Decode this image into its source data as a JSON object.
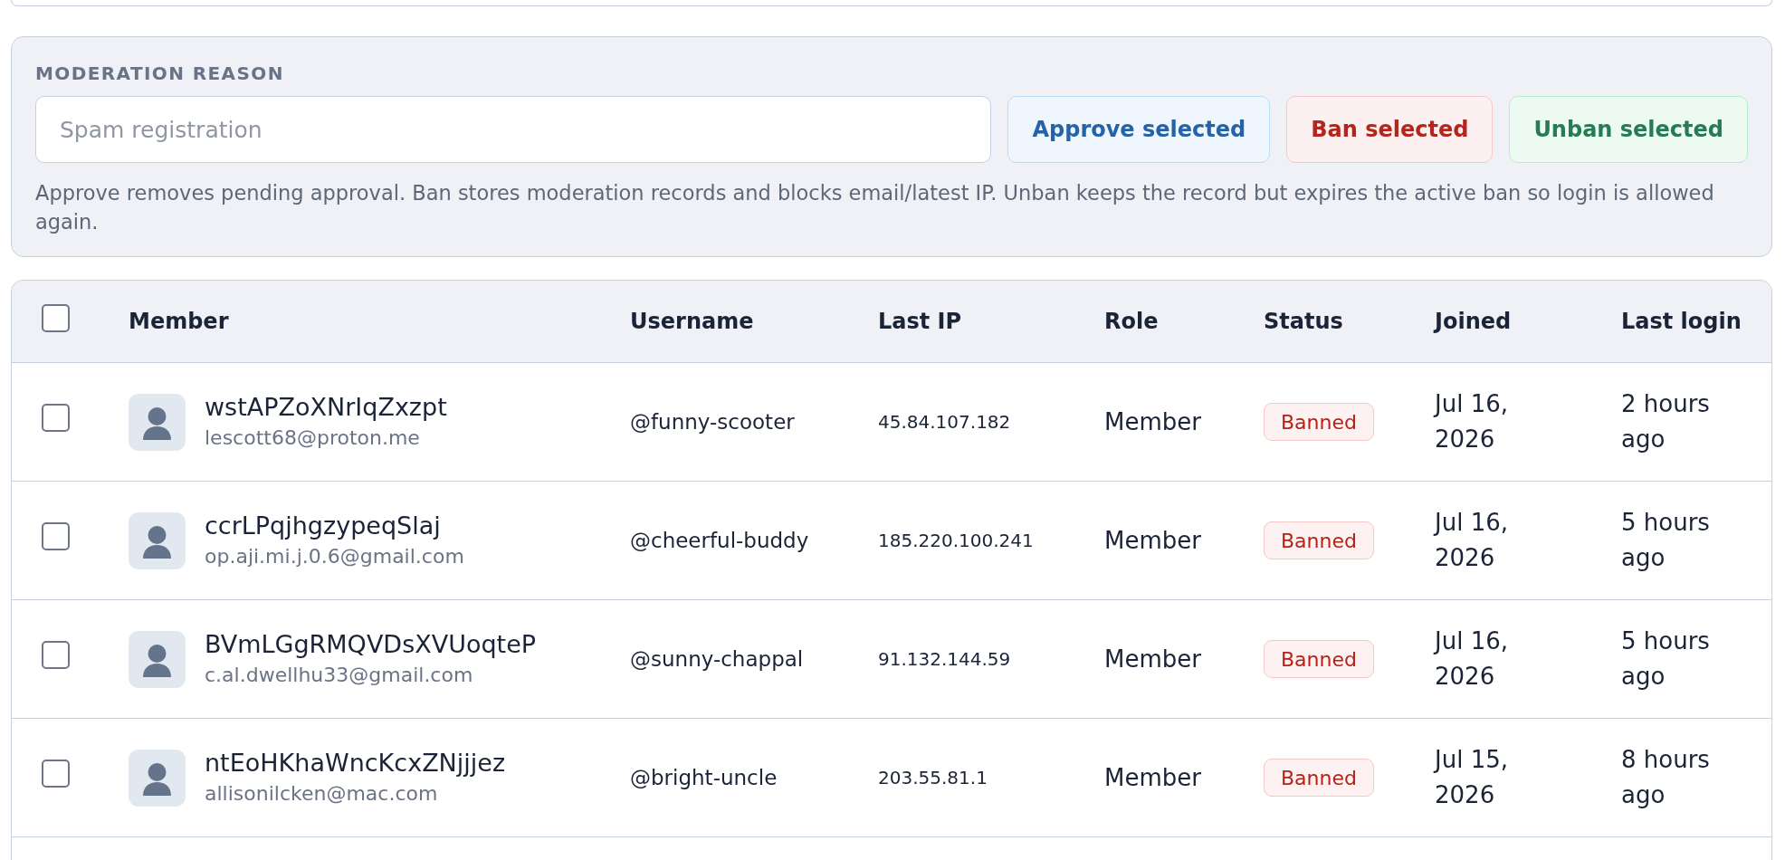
{
  "moderation": {
    "label": "MODERATION REASON",
    "reason_field": {
      "placeholder": "Spam registration"
    },
    "actions": [
      {
        "label": "Approve selected",
        "kind": "approve"
      },
      {
        "label": "Ban selected",
        "kind": "ban"
      },
      {
        "label": "Unban selected",
        "kind": "unban"
      }
    ],
    "help_text": "Approve removes pending approval. Ban stores moderation records and blocks email/latest IP. Unban keeps the record but expires the active ban so login is allowed again."
  },
  "table": {
    "select_all": {
      "checked": false
    },
    "columns": [
      "Member",
      "Username",
      "Last IP",
      "Role",
      "Status",
      "Joined",
      "Last login"
    ],
    "rows": [
      {
        "checked": false,
        "name": "wstAPZoXNrIqZxzpt",
        "email": "lescott68@proton.me",
        "username": "@funny-scooter",
        "last_ip": "45.84.107.182",
        "role": "Member",
        "status": {
          "label": "Banned",
          "kind": "banned"
        },
        "joined": "Jul 16, 2026",
        "last_login": "2 hours ago"
      },
      {
        "checked": false,
        "name": "ccrLPqjhgzypeqSlaj",
        "email": "op.aji.mi.j.0.6@gmail.com",
        "username": "@cheerful-buddy",
        "last_ip": "185.220.100.241",
        "role": "Member",
        "status": {
          "label": "Banned",
          "kind": "banned"
        },
        "joined": "Jul 16, 2026",
        "last_login": "5 hours ago"
      },
      {
        "checked": false,
        "name": "BVmLGgRMQVDsXVUoqteP",
        "email": "c.al.dwellhu33@gmail.com",
        "username": "@sunny-chappal",
        "last_ip": "91.132.144.59",
        "role": "Member",
        "status": {
          "label": "Banned",
          "kind": "banned"
        },
        "joined": "Jul 16, 2026",
        "last_login": "5 hours ago"
      },
      {
        "checked": false,
        "name": "ntEoHKhaWncKcxZNjjjez",
        "email": "allisonilcken@mac.com",
        "username": "@bright-uncle",
        "last_ip": "203.55.81.1",
        "role": "Member",
        "status": {
          "label": "Banned",
          "kind": "banned"
        },
        "joined": "Jul 15, 2026",
        "last_login": "8 hours ago"
      }
    ]
  }
}
